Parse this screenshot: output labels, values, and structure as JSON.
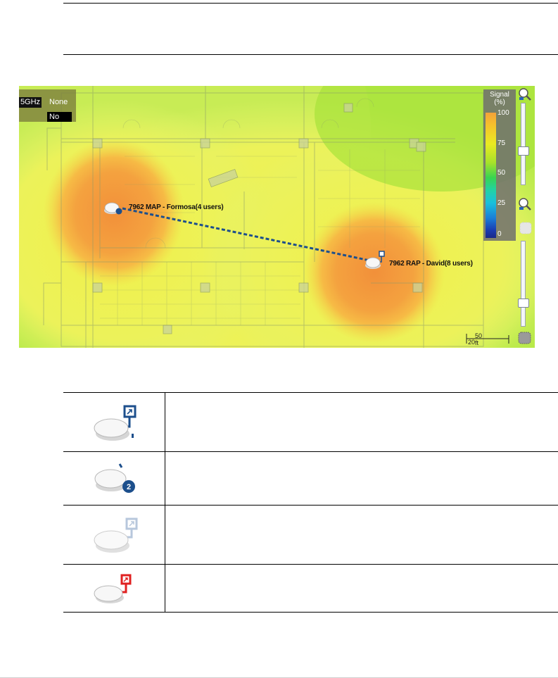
{
  "map": {
    "band_label": "5GHz",
    "band_value": "None",
    "toggle_value": "No",
    "access_points": [
      {
        "name": "7962 MAP - Formosa(4 users)",
        "type": "MAP",
        "badge": "1"
      },
      {
        "name": "7962 RAP - David(8 users)",
        "type": "RAP"
      }
    ],
    "signal_legend": {
      "title": "Signal (%)",
      "ticks": [
        "100",
        "75",
        "50",
        "25",
        "0"
      ]
    },
    "scale": {
      "feet": "50 ft",
      "meters": "20 m"
    }
  },
  "icon_legend": [
    {
      "icon": "rap-icon",
      "description": ""
    },
    {
      "icon": "map-icon",
      "description": ""
    },
    {
      "icon": "rap-faded-icon",
      "description": ""
    },
    {
      "icon": "rap-red-icon",
      "description": ""
    }
  ],
  "colors": {
    "heat_high": "#f4a23a",
    "heat_mid": "#eaea22",
    "heat_low": "#a8e23a",
    "link_line": "#1d4f8c",
    "ap_badge": "#1d4f8c",
    "alert": "#e02020"
  }
}
